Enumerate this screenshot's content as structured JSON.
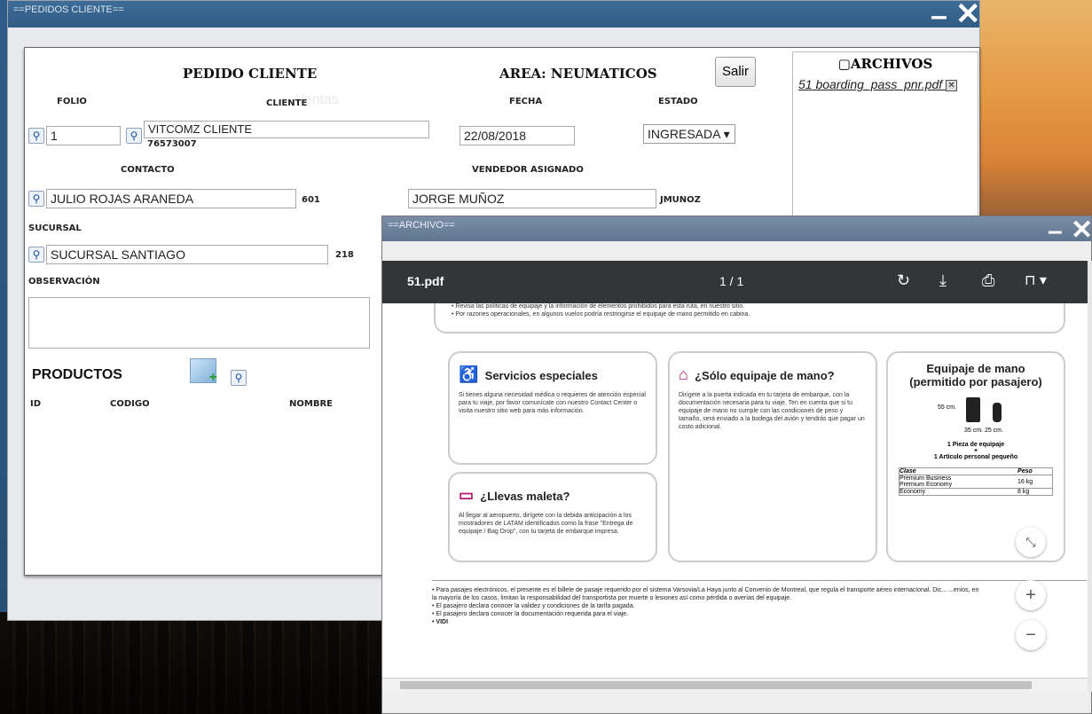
{
  "outer_window": {
    "title": "==PEDIDOS CLIENTE=="
  },
  "form": {
    "title": "PEDIDO CLIENTE",
    "area": "AREA: NEUMATICOS",
    "salir": "Salir",
    "labels": {
      "folio": "FOLIO",
      "cliente": "CLIENTE",
      "fecha": "FECHA",
      "estado": "ESTADO",
      "contacto": "CONTACTO",
      "vendedor": "VENDEDOR ASIGNADO",
      "sucursal": "SUCURSAL",
      "observacion": "OBSERVACIÓN"
    },
    "folio": "1",
    "cliente": "VITCOMZ CLIENTE",
    "cliente_rut": "76573007",
    "fecha": "22/08/2018",
    "estado": "INGRESADA ▾",
    "contacto": "JULIO  ROJAS ARANEDA",
    "contacto_code": "601",
    "vendedor": "JORGE MUÑOZ",
    "vendedor_code": "JMUNOZ",
    "sucursal": "SUCURSAL SANTIAGO",
    "sucursal_code": "218",
    "productos": {
      "title": "PRODUCTOS",
      "columns": [
        "ID",
        "CODIGO",
        "NOMBRE"
      ]
    }
  },
  "archivos": {
    "title": "ARCHIVOS",
    "file_number": "51",
    "file_name": "boarding_pass_pnr.pdf"
  },
  "pdf_window": {
    "title": "==ARCHIVO==",
    "filename": "51.pdf",
    "page_indicator": "1 / 1",
    "top_notes": [
      "• Revisa las políticas de equipaje y la información de elementos prohibidos para esta ruta, en nuestro sitio.",
      "• Por razones operacionales, en algunos vuelos podría restringirse el equipaje de mano permitido en cabina."
    ],
    "servicios": {
      "title": "Servicios especiales",
      "text": "Si tienes alguna necesidad médica o requieres de atención especial para tu viaje, por favor comunícate con nuestro Contact Center o visita nuestro sitio web para más información."
    },
    "solo_mano": {
      "title": "¿Sólo equipaje de mano?",
      "text": "Dirígete a la puerta indicada en tu tarjeta de embarque, con la documentación necesaria para tu viaje. Ten en cuenta que si tu equipaje de mano no cumple con las condiciones de peso y tamaño, será enviado a la bodega del avión y tendrás que pagar un costo adicional."
    },
    "maleta": {
      "title": "¿Llevas maleta?",
      "text": "Al llegar al aeropuerto, dirígete con la debida anticipación a los mostradores de LATAM identificados como la frase \"Entrega de equipaje / Bag Drop\", con tu tarjeta de embarque impresa."
    },
    "equipaje": {
      "title": "Equipaje de mano",
      "subtitle": "(permitido por pasajero)",
      "height": "55 cm.",
      "dims": "35 cm.  25 cm.",
      "pieza": "1 Pieza de equipaje",
      "plus": "+",
      "articulo": "1 Artículo personal pequeño",
      "col_clase": "Clase",
      "col_peso": "Peso",
      "row1a": "Premium Business",
      "row1b": "Premium Economy",
      "row1_peso": "16 kg",
      "row2": "Economy",
      "row2_peso": "8 kg"
    },
    "footer": [
      "• Para pasajes electrónicos, el presente es el billete de pasaje requerido por el sistema Varsovia/La Haya junto al Convenio de Montreal, que regula el transporte aéreo internacional. Dic... ...enios, en",
      "la mayoría de los casos, limitan la responsabilidad del transportista por muerte o lesiones así como pérdida o averías del equipaje.",
      "• El pasajero declara conocer la validez y condiciones de la tarifa pagada.",
      "• El pasajero declara conocer la documentación requerida para el viaje.",
      "• VIDI"
    ]
  }
}
